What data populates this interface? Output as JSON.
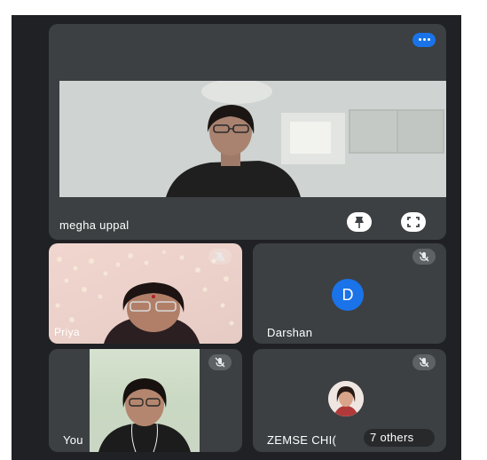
{
  "main": {
    "name": "megha uppal"
  },
  "tiles": [
    {
      "name": "Priya"
    },
    {
      "name": "Darshan",
      "initial": "D"
    },
    {
      "name": "You"
    },
    {
      "name": "ZEMSE CHI(",
      "others": "7 others"
    }
  ],
  "colors": {
    "background": "#202124",
    "tile": "#3c4043",
    "accent": "#1a73e8",
    "text": "#ffffff"
  },
  "icons": [
    "more-options-icon",
    "pin-icon",
    "fullscreen-icon",
    "mic-off-icon"
  ]
}
